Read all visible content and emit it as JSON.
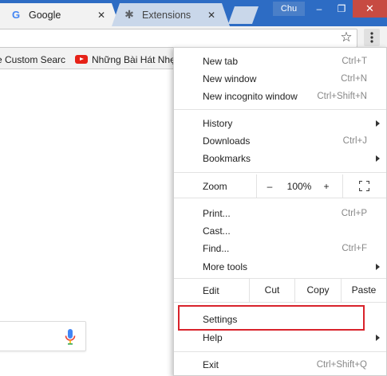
{
  "tabs": [
    {
      "title": "Google",
      "close": "✕"
    },
    {
      "title": "Extensions",
      "close": "✕"
    }
  ],
  "profile": {
    "name": "Chu"
  },
  "window_controls": {
    "minimize": "–",
    "maximize": "❐",
    "close": "✕"
  },
  "bookmarks": [
    {
      "label": "e Custom Searc"
    },
    {
      "label": "Những Bài Hát Nhẹ"
    }
  ],
  "menu": {
    "new_tab": {
      "label": "New tab",
      "shortcut": "Ctrl+T"
    },
    "new_window": {
      "label": "New window",
      "shortcut": "Ctrl+N"
    },
    "new_incognito": {
      "label": "New incognito window",
      "shortcut": "Ctrl+Shift+N"
    },
    "history": {
      "label": "History"
    },
    "downloads": {
      "label": "Downloads",
      "shortcut": "Ctrl+J"
    },
    "bookmarks": {
      "label": "Bookmarks"
    },
    "zoom": {
      "label": "Zoom",
      "minus": "–",
      "value": "100%",
      "plus": "+"
    },
    "print": {
      "label": "Print...",
      "shortcut": "Ctrl+P"
    },
    "cast": {
      "label": "Cast..."
    },
    "find": {
      "label": "Find...",
      "shortcut": "Ctrl+F"
    },
    "more_tools": {
      "label": "More tools"
    },
    "edit": {
      "label": "Edit",
      "cut": "Cut",
      "copy": "Copy",
      "paste": "Paste"
    },
    "settings": {
      "label": "Settings"
    },
    "help": {
      "label": "Help"
    },
    "exit": {
      "label": "Exit",
      "shortcut": "Ctrl+Shift+Q"
    }
  },
  "colors": {
    "titlebar": "#2d6cc4",
    "highlight": "#d9232b",
    "close_button": "#c74b42"
  }
}
